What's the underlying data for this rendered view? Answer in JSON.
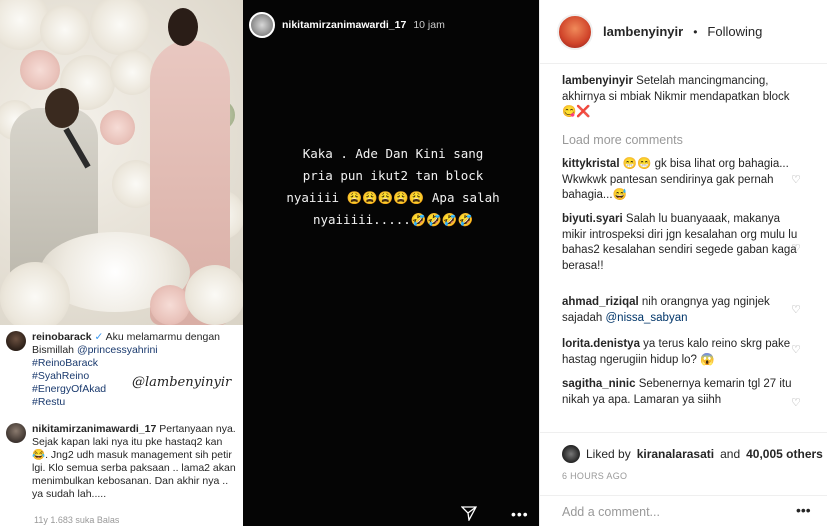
{
  "left_post": {
    "reino": {
      "username": "reinobarack",
      "text": "Aku melamarmu dengan Bismillah",
      "mention": "@princessyahrini",
      "hashtags": [
        "#ReinoBarack",
        "#SyahReino",
        "#EnergyOfAkad",
        "#Restu"
      ]
    },
    "watermark": "@lambenyinyir",
    "nikita": {
      "username": "nikitamirzanimawardi_17",
      "text": "Pertanyaan nya. Sejak kapan laki nya itu pke hastaq2 kan 😂. Jng2 udh masuk management sih petir lgi. Klo semua serba paksaan .. lama2 akan menimbulkan kebosanan. Dan akhir nya .. ya sudah lah....."
    },
    "meta": "11y   1.683 suka   Balas"
  },
  "story": {
    "username": "nikitamirzanimawardi_17",
    "time": "10 jam",
    "text": "Kaka . Ade Dan  Kini sang\npria pun ikut2 tan block\nnyaiiii 😩😩😩😩😩 Apa salah\nnyaiiiii.....🤣🤣🤣🤣",
    "send_icon": "send-icon",
    "more_icon": "more-icon"
  },
  "right_panel": {
    "header": {
      "username": "lambenyinyir",
      "separator": "•",
      "follow_status": "Following"
    },
    "caption": {
      "username": "lambenyinyir",
      "text": "Setelah mancingmancing, akhirnya si mbiak Nikmir mendapatkan block 😋❌"
    },
    "load_more": "Load more comments",
    "comments": [
      {
        "username": "kittykristal",
        "text": "😁😁 gk bisa lihat org bahagia... Wkwkwk pantesan sendirinya gak pernah bahagia...😅"
      },
      {
        "username": "biyuti.syari",
        "text": "Salah lu buanyaaak, makanya mikir introspeksi diri jgn kesalahan org mulu lu bahas2 kesalahan sendiri segede gaban kaga berasa!!"
      },
      {
        "username": "ahmad_riziqal",
        "text": "nih orangnya yag nginjek sajadah",
        "mention": "@nissa_sabyan"
      },
      {
        "username": "lorita.denistya",
        "text": "ya terus kalo reino skrg pake hastag ngerugiin hidup lo? 😱"
      },
      {
        "username": "sagitha_ninic",
        "text": "Sebenernya kemarin tgl 27 itu nikah ya apa. Lamaran ya siihh"
      }
    ],
    "likes": {
      "liked_by": "Liked by",
      "user": "kiranalarasati",
      "and": "and",
      "count": "40,005 others"
    },
    "time_ago": "6 HOURS AGO",
    "add_comment_placeholder": "Add a comment...",
    "more_label": "•••"
  }
}
